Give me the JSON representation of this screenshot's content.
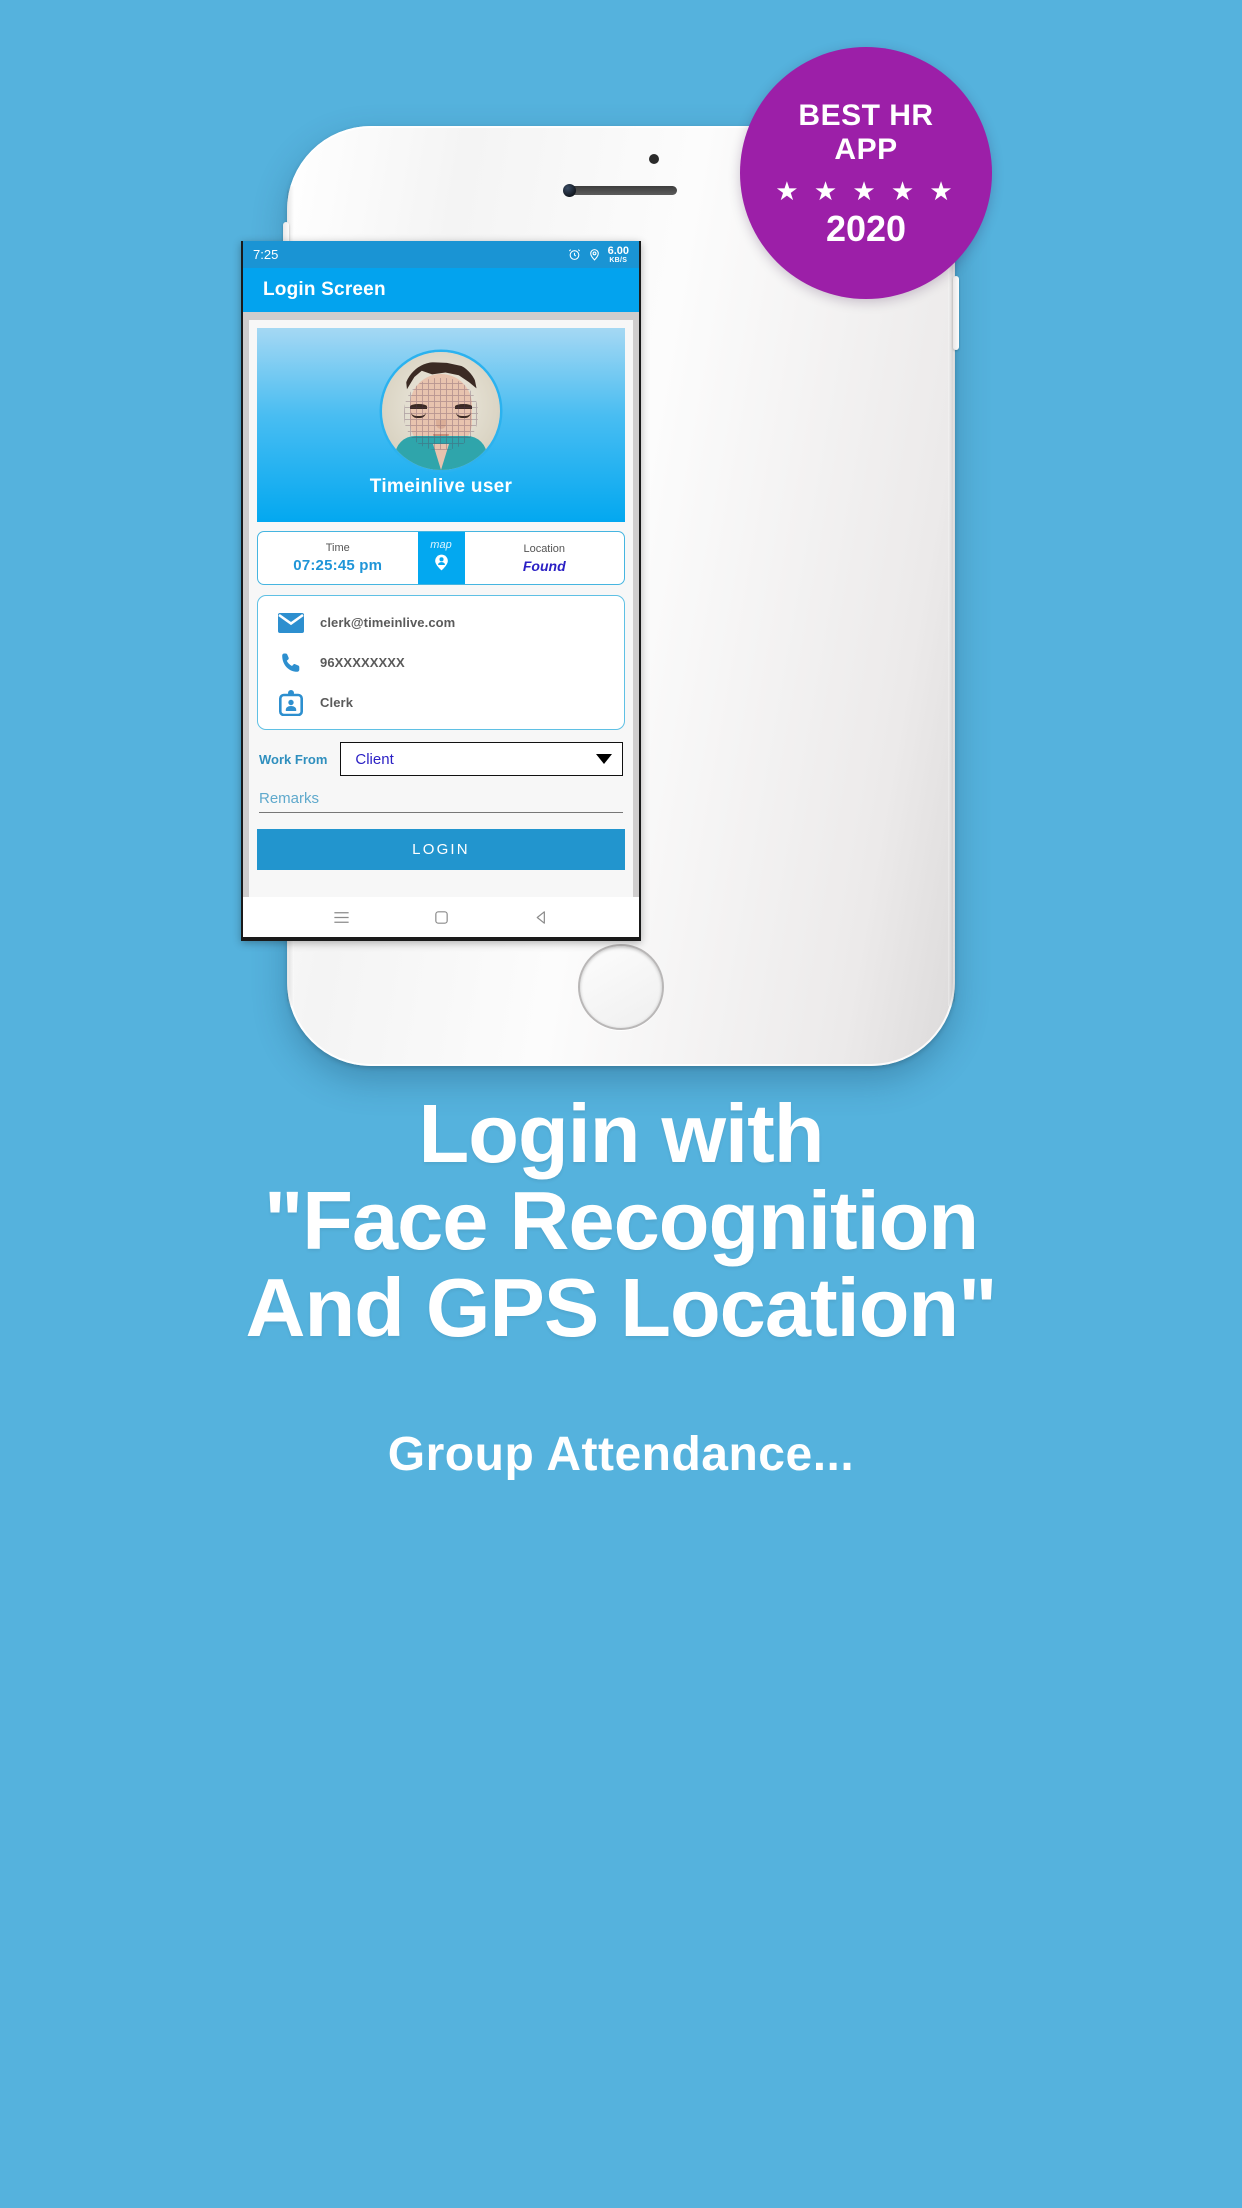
{
  "badge": {
    "line1": "BEST HR",
    "line2": "APP",
    "stars": "★ ★ ★ ★ ★",
    "year": "2020",
    "color": "#9c1fa8"
  },
  "phone": {
    "status_bar": {
      "time": "7:25",
      "alarm_icon": "alarm-clock-icon",
      "location_icon": "location-pin-icon",
      "net_speed_value": "6.00",
      "net_speed_unit": "KB/S"
    },
    "app_bar": {
      "title": "Login Screen",
      "color": "#03a8f0"
    },
    "hero": {
      "avatar_icon": "user-face-avatar",
      "name": "Timeinlive user"
    },
    "info_row": {
      "time_label": "Time",
      "time_value": "07:25:45 pm",
      "map_label": "map",
      "map_icon": "person-pin-icon",
      "location_label": "Location",
      "location_value": "Found"
    },
    "contact": [
      {
        "icon": "envelope-icon",
        "value": "clerk@timeinlive.com"
      },
      {
        "icon": "phone-icon",
        "value": "96XXXXXXXX"
      },
      {
        "icon": "id-badge-icon",
        "value": "Clerk"
      }
    ],
    "form": {
      "work_from_label": "Work From",
      "work_from_value": "Client",
      "dropdown_icon": "chevron-down-icon",
      "remarks_placeholder": "Remarks",
      "login_label": "LOGIN"
    },
    "nav_bar": {
      "recents_icon": "menu-icon",
      "home_icon": "home-square-icon",
      "back_icon": "back-triangle-icon"
    }
  },
  "marketing": {
    "headline_line1": "Login with",
    "headline_line2": "\"Face Recognition",
    "headline_line3": "And GPS Location\"",
    "subline": "Group Attendance..."
  },
  "background_color": "#55b2dd"
}
